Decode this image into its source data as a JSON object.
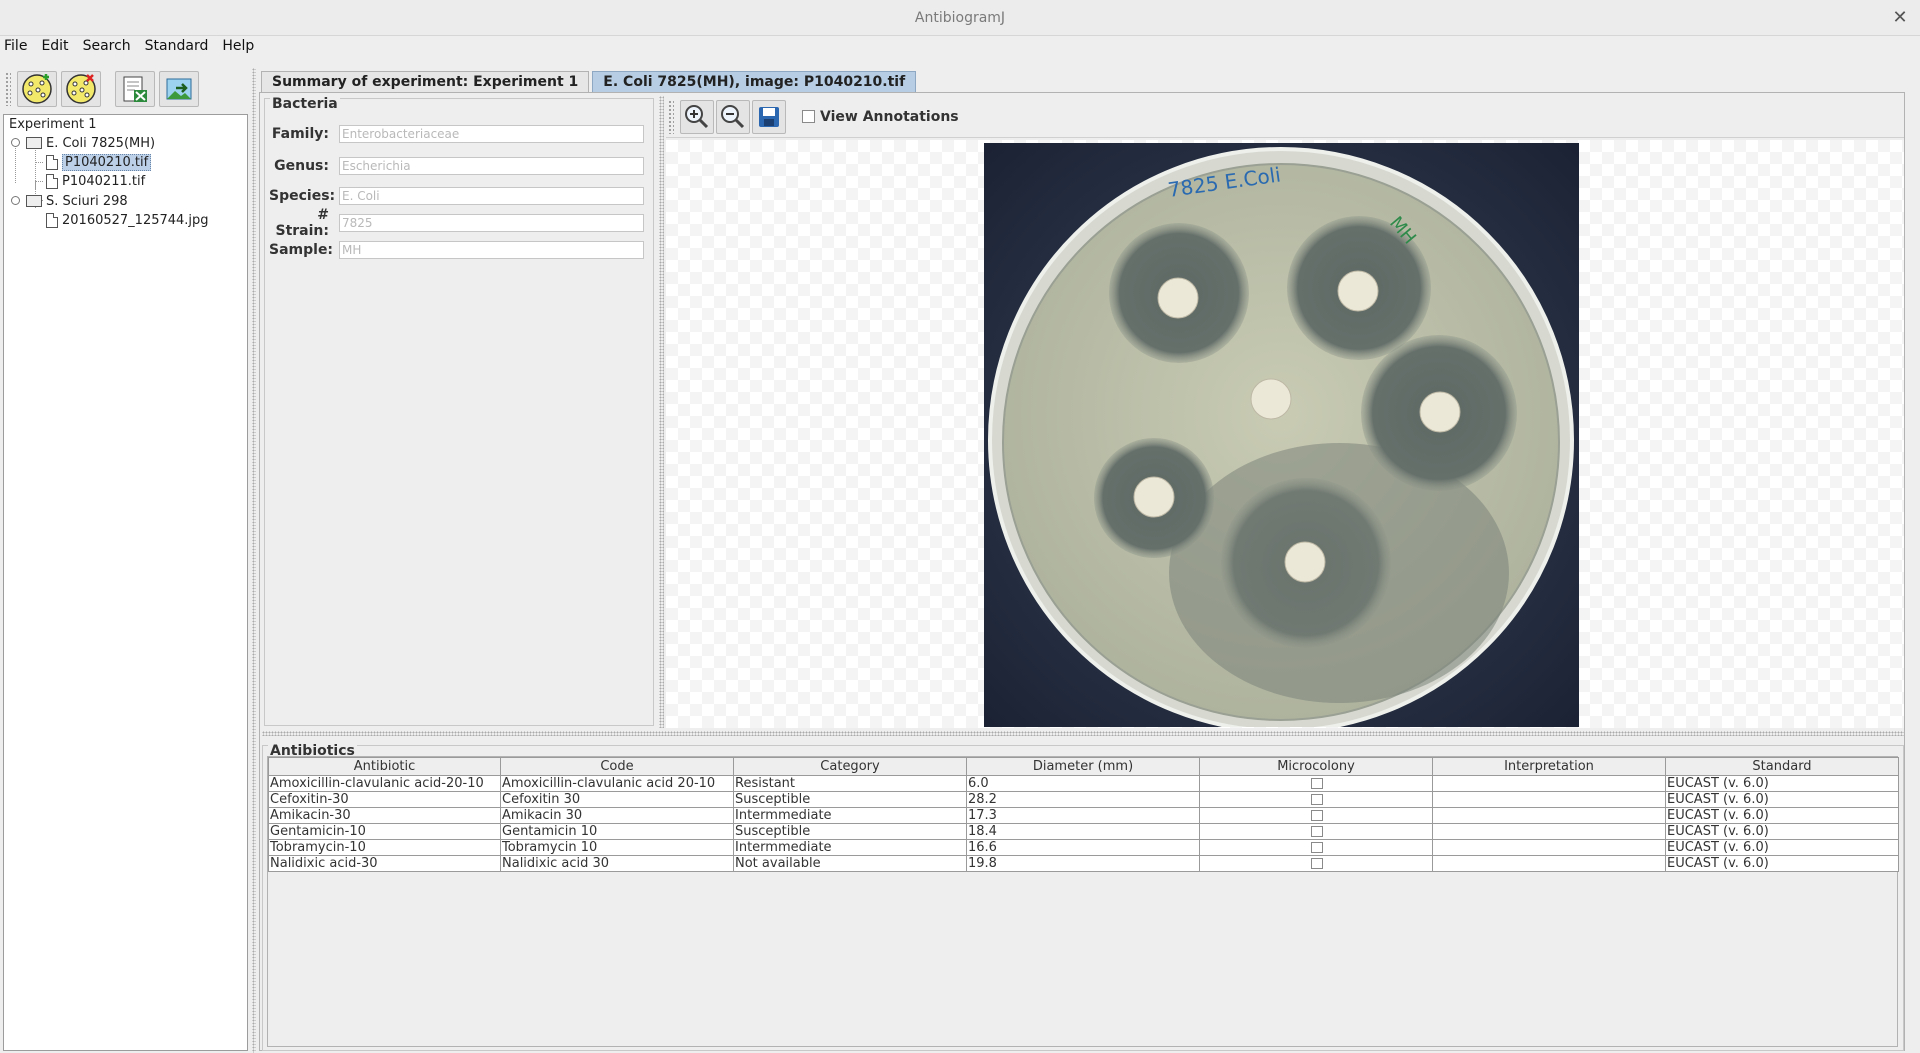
{
  "window": {
    "title": "AntibiogramJ"
  },
  "menu": [
    "File",
    "Edit",
    "Search",
    "Standard",
    "Help"
  ],
  "tree": {
    "root": "Experiment 1",
    "items": [
      {
        "label": "E. Coli 7825(MH)",
        "children": [
          "P1040210.tif",
          "P1040211.tif"
        ]
      },
      {
        "label": "S. Sciuri 298",
        "children": [
          "20160527_125744.jpg"
        ]
      }
    ],
    "selected": "P1040210.tif"
  },
  "tabs": [
    "Summary of experiment: Experiment 1",
    "E. Coli 7825(MH), image: P1040210.tif"
  ],
  "bacteria": {
    "title": "Bacteria",
    "fields": [
      {
        "label": "Family:",
        "value": "Enterobacteriaceae"
      },
      {
        "label": "Genus:",
        "value": "Escherichia"
      },
      {
        "label": "Species:",
        "value": "E. Coli"
      },
      {
        "label": "# Strain:",
        "value": "7825"
      },
      {
        "label": "Sample:",
        "value": "MH"
      }
    ]
  },
  "viewer": {
    "view_annotations_label": "View Annotations",
    "view_annotations_checked": false,
    "plate_label": "7825 E.Coli",
    "plate_mark": "MH"
  },
  "antibiotics": {
    "title": "Antibiotics",
    "columns": [
      "Antibiotic",
      "Code",
      "Category",
      "Diameter (mm)",
      "Microcolony",
      "Interpretation",
      "Standard"
    ],
    "rows": [
      [
        "Amoxicillin-clavulanic acid-20-10",
        "Amoxicillin-clavulanic acid 20-10",
        "Resistant",
        "6.0",
        "",
        "",
        "EUCAST (v. 6.0)"
      ],
      [
        "Cefoxitin-30",
        "Cefoxitin 30",
        "Susceptible",
        "28.2",
        "",
        "",
        "EUCAST (v. 6.0)"
      ],
      [
        "Amikacin-30",
        "Amikacin 30",
        "Intermmediate",
        "17.3",
        "",
        "",
        "EUCAST (v. 6.0)"
      ],
      [
        "Gentamicin-10",
        "Gentamicin 10",
        "Susceptible",
        "18.4",
        "",
        "",
        "EUCAST (v. 6.0)"
      ],
      [
        "Tobramycin-10",
        "Tobramycin 10",
        "Intermmediate",
        "16.6",
        "",
        "",
        "EUCAST (v. 6.0)"
      ],
      [
        "Nalidixic acid-30",
        "Nalidixic acid 30",
        "Not available",
        "19.8",
        "",
        "",
        "EUCAST (v. 6.0)"
      ]
    ]
  }
}
